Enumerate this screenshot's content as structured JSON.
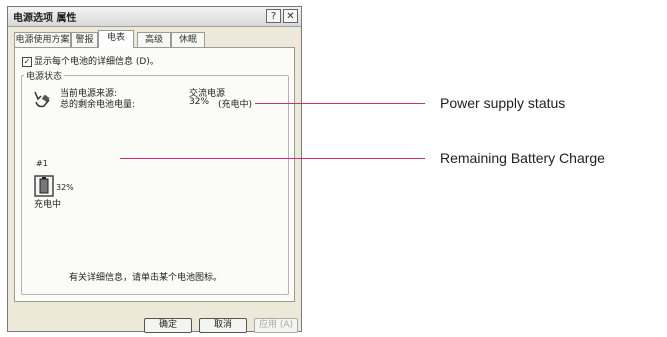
{
  "window": {
    "title": "电源选项 属性",
    "help_glyph": "?",
    "close_glyph": "✕"
  },
  "tabs": [
    {
      "label": "电源使用方案"
    },
    {
      "label": "警报"
    },
    {
      "label": "电表"
    },
    {
      "label": "高级"
    },
    {
      "label": "休眠"
    }
  ],
  "active_tab": "电表",
  "panel": {
    "show_details_checkbox": {
      "label": "显示每个电池的详细信息 (D)。",
      "checked": true
    },
    "group_title": "电源状态",
    "power_source_label": "当前电源来源:",
    "power_source_value": "交流电源",
    "remaining_label": "总的剩余电池电量:",
    "remaining_value": "32%",
    "remaining_status": "(充电中)",
    "battery": {
      "number": "#1",
      "percent": "32%",
      "state": "充电中"
    },
    "hint": "有关详细信息，请单击某个电池图标。"
  },
  "buttons": {
    "ok": "确定",
    "cancel": "取消",
    "apply": "应用 (A)"
  },
  "callouts": {
    "power_supply": "Power supply status",
    "remaining_charge": "Remaining Battery Charge"
  },
  "colors": {
    "callout_line": "#c8307a"
  }
}
